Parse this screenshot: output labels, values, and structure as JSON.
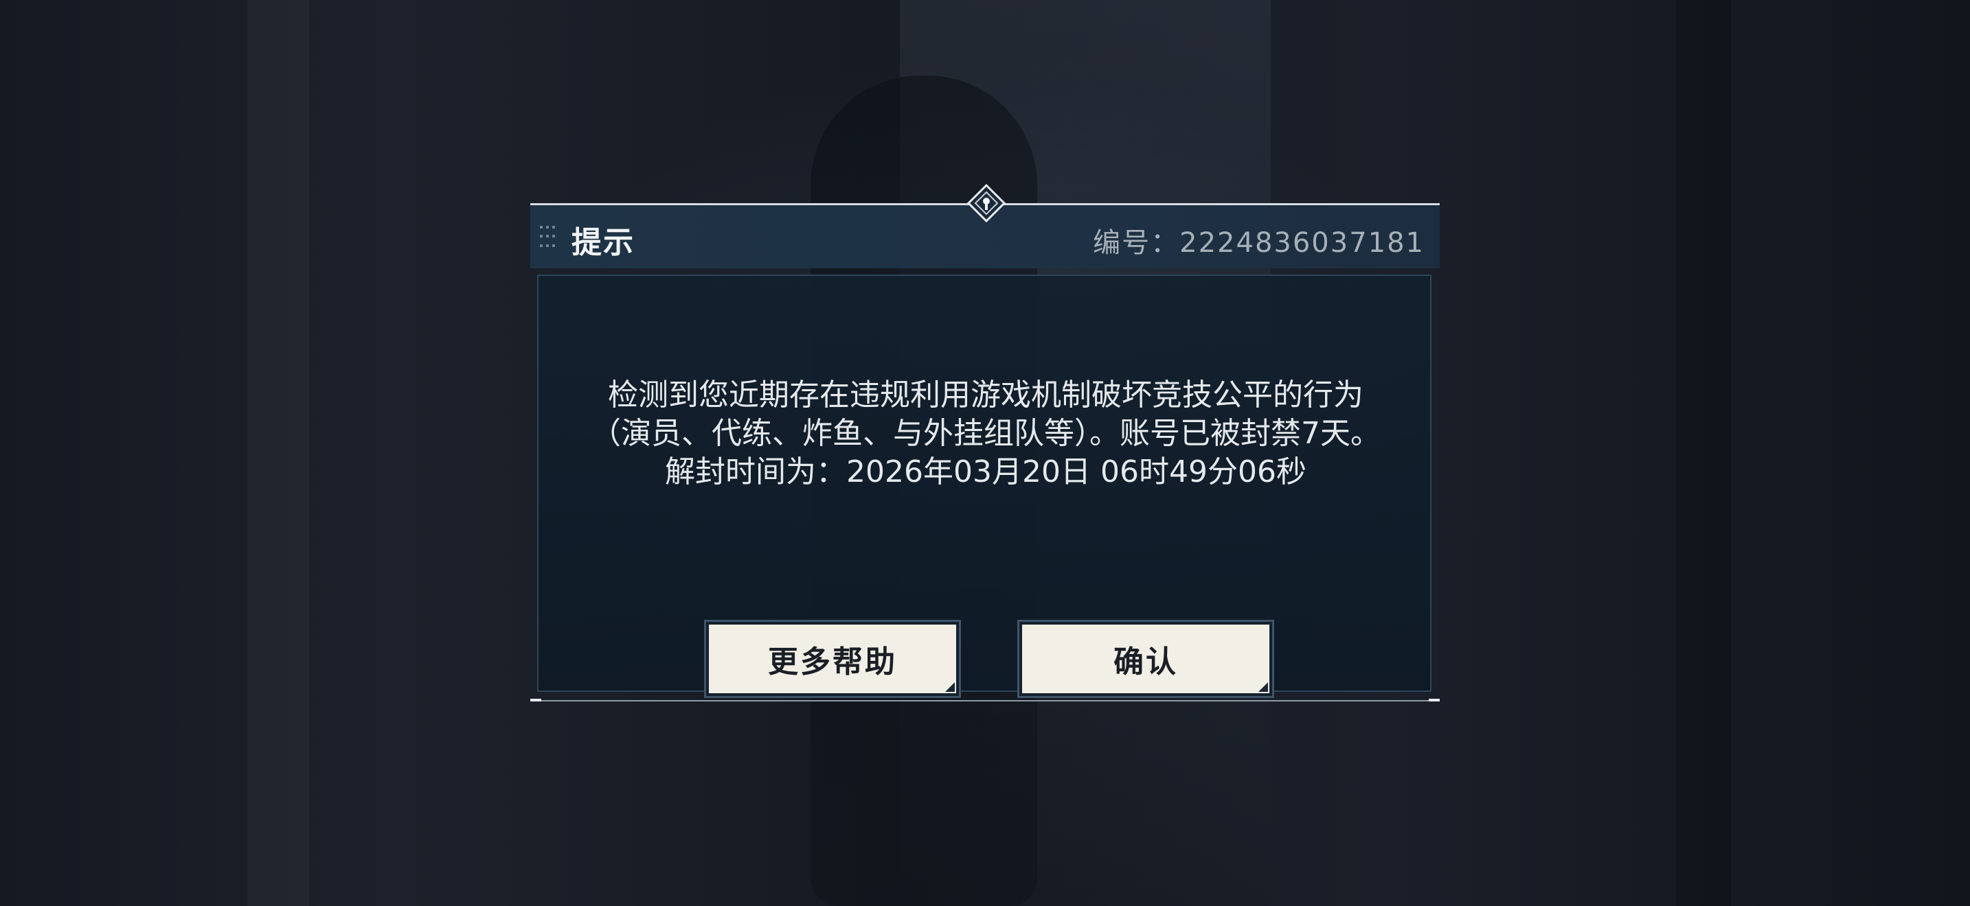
{
  "dialog": {
    "title": "提示",
    "serial": "编号：2224836037181",
    "message": {
      "line1": "检测到您近期存在违规利用游戏机制破坏竞技公平的行为",
      "line2": "（演员、代练、炸鱼、与外挂组队等）。账号已被封禁7天。",
      "line3": "解封时间为：2026年03月20日 06时49分06秒"
    },
    "buttons": {
      "help": "更多帮助",
      "confirm": "确认"
    }
  },
  "icons": {
    "grip": "drag-grip-icon",
    "top_emblem": "diamond-emblem-icon"
  },
  "colors": {
    "header_bg": "#1f3346",
    "panel_bg": "#12202e",
    "button_bg": "#f2efe6",
    "text": "#e6e9ec"
  }
}
